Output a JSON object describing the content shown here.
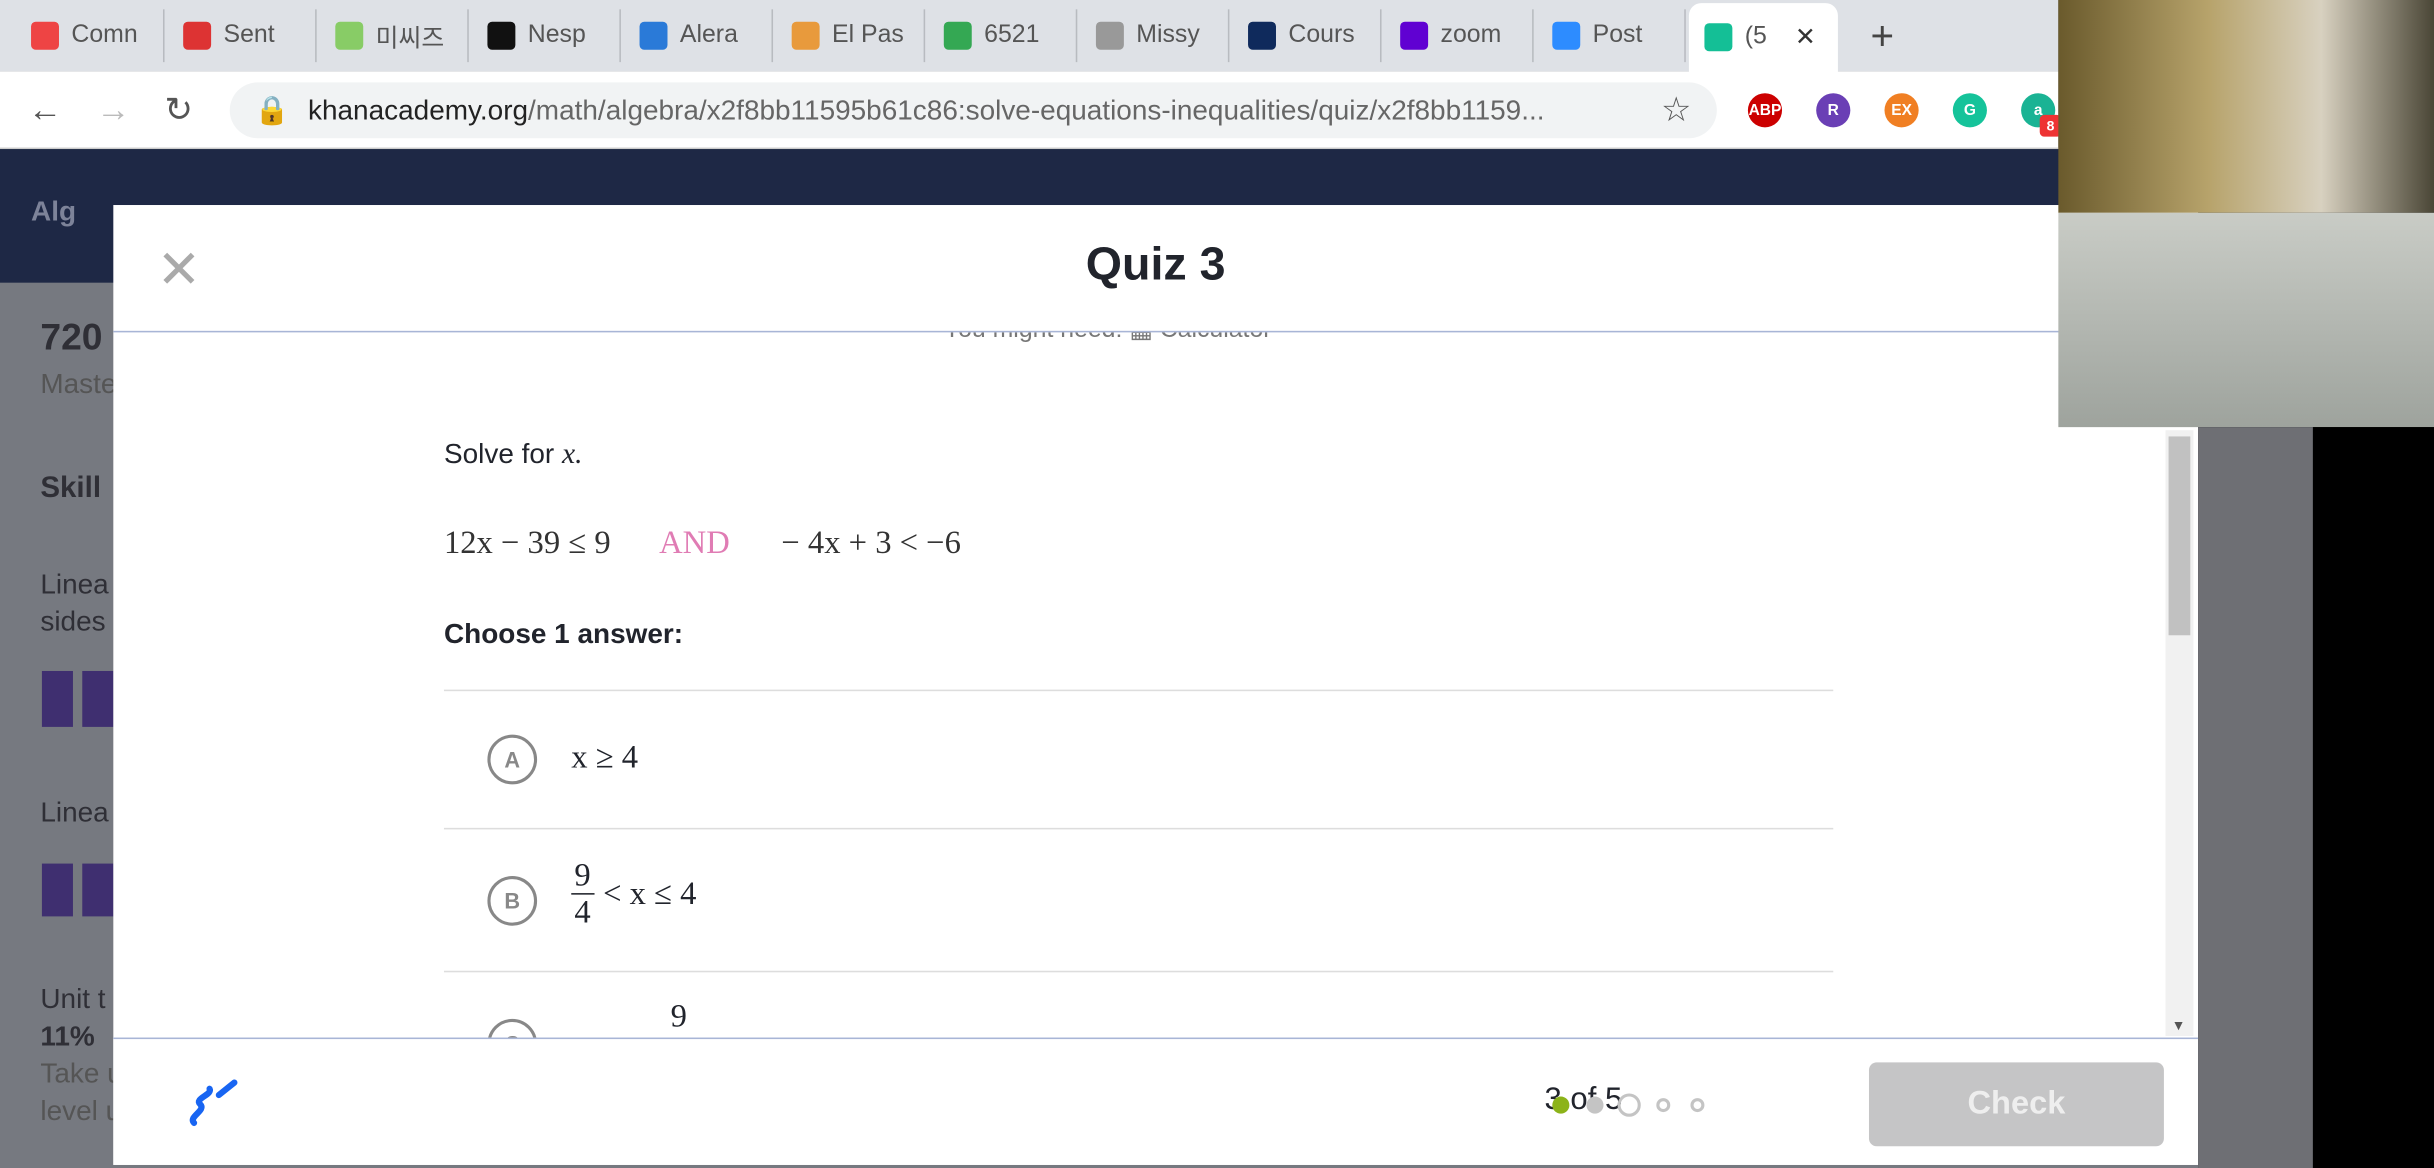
{
  "browser": {
    "tabs": [
      {
        "label": "Comn",
        "icon": "xodo-icon",
        "color": "#e44"
      },
      {
        "label": "Sent",
        "icon": "gmail-icon",
        "color": "#d33"
      },
      {
        "label": "미씨즈",
        "icon": "flower-icon",
        "color": "#8c6"
      },
      {
        "label": "Nesp",
        "icon": "b-icon",
        "color": "#111"
      },
      {
        "label": "Alera",
        "icon": "diamond-icon",
        "color": "#2a7ad8"
      },
      {
        "label": "El Pas",
        "icon": "c-icon",
        "color": "#e89a3c"
      },
      {
        "label": "6521",
        "icon": "maps-pin-icon",
        "color": "#34a853"
      },
      {
        "label": "Missy",
        "icon": "pinwheel-icon",
        "color": "#999"
      },
      {
        "label": "Cours",
        "icon": "yale-y-icon",
        "color": "#0f2a5c"
      },
      {
        "label": "zoom",
        "icon": "yahoo-icon",
        "color": "#6001d2"
      },
      {
        "label": "Post",
        "icon": "zoom-icon",
        "color": "#2d8cff"
      },
      {
        "label": "(5",
        "icon": "khan-icon",
        "color": "#14bf96",
        "active": true
      }
    ],
    "url_domain": "khanacademy.org",
    "url_path": "/math/algebra/x2f8bb11595b61c86:solve-equations-inequalities/quiz/x2f8bb1159...",
    "extensions": [
      {
        "label": "ABP",
        "color": "#c00"
      },
      {
        "label": "R",
        "color": "#6a3fb5"
      },
      {
        "label": "EX",
        "color": "#f07f23"
      },
      {
        "label": "G",
        "color": "#15c39a"
      },
      {
        "label": "a",
        "color": "#1ab394"
      }
    ],
    "ext_badge": "8"
  },
  "background_page": {
    "back_label": "Alg",
    "score": "720",
    "mastery": "Maste",
    "skill": "Skill",
    "items": [
      "Linea",
      "sides",
      "Linea"
    ],
    "unit": "Unit t",
    "percent": "11%",
    "take": "Take u",
    "level": "level u"
  },
  "quiz": {
    "title": "Quiz 3",
    "might_need": "You might need:",
    "calculator": "Calculator",
    "prompt": "Solve for",
    "prompt_var": "x.",
    "eq1": "12x − 39 ≤ 9",
    "and": "AND",
    "eq2": "− 4x + 3 < −6",
    "and_color": "#e07cb4",
    "choose": "Choose 1 answer:",
    "options": [
      {
        "letter": "A",
        "text": "x ≥ 4"
      },
      {
        "letter": "B",
        "num": "9",
        "den": "4",
        "text": "< x ≤ 4"
      },
      {
        "letter": "C",
        "num": "9"
      }
    ],
    "progress": "3 of 5",
    "current_question": 3,
    "total_questions": 5,
    "check": "Check",
    "accent": "#8cb319"
  }
}
